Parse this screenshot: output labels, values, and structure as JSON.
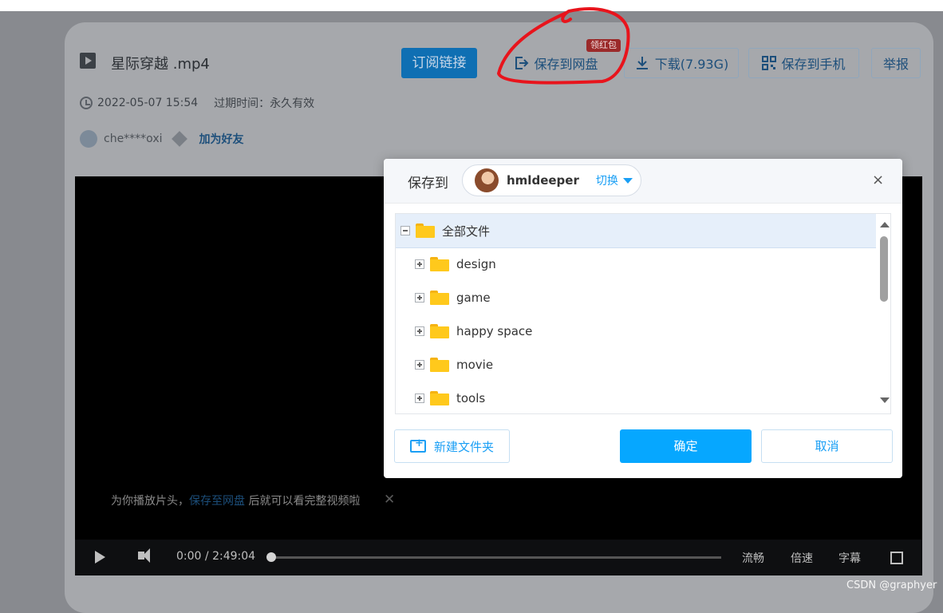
{
  "page": {
    "file_title": "星际穿越 .mp4",
    "buttons": {
      "subscribe": "订阅链接",
      "save_to_disk": "保存到网盘",
      "red_badge": "领红包",
      "download": "下载(7.93G)",
      "save_to_phone": "保存到手机",
      "report": "举报"
    },
    "meta": {
      "datetime": "2022-05-07 15:54",
      "expire": "过期时间：永久有效"
    },
    "user": {
      "name": "che****oxi",
      "add_friend": "加为好友"
    }
  },
  "player": {
    "tip_prefix": "为你播放片头，",
    "tip_link": "保存至网盘",
    "tip_suffix": " 后就可以看完整视频啦",
    "tip_close": "✕",
    "current_time": "0:00",
    "time_separator": "/",
    "duration": "2:49:04",
    "progress_fraction": 0.0,
    "quality": "流畅",
    "speed": "倍速",
    "subtitle": "字幕"
  },
  "dialog": {
    "title": "保存到",
    "account_name": "hmldeeper",
    "switch_label": "切换",
    "close": "×",
    "tree": {
      "root": "全部文件",
      "folders": [
        "design",
        "game",
        "happy space",
        "movie",
        "tools"
      ]
    },
    "new_folder": "新建文件夹",
    "confirm": "确定",
    "cancel": "取消"
  },
  "watermark": "CSDN @graphyer",
  "colors": {
    "accent": "#06a7ff",
    "annotation": "#e8141c",
    "folder": "#ffc91c"
  }
}
